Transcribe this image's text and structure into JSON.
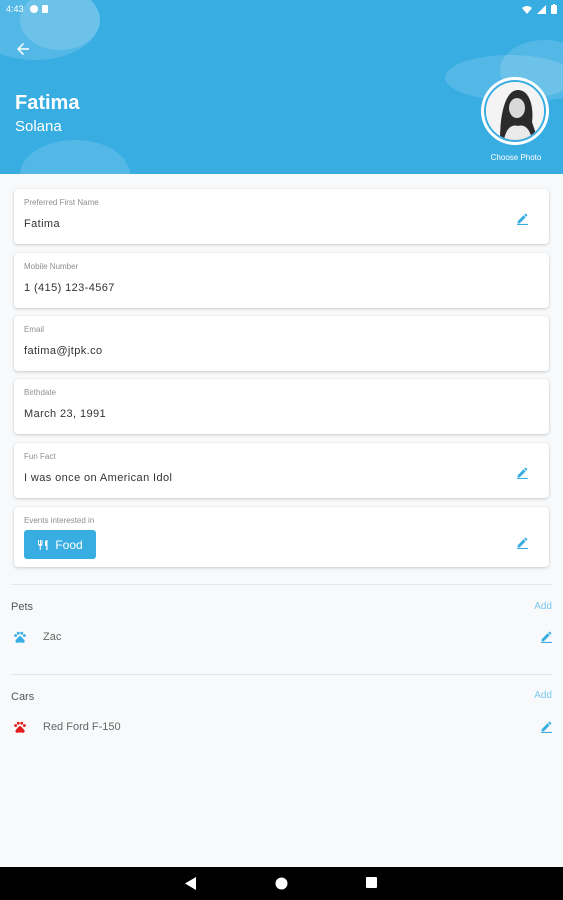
{
  "status_bar": {
    "time": "4:43"
  },
  "header": {
    "first_name": "Fatima",
    "last_name": "Solana",
    "choose_photo_label": "Choose Photo"
  },
  "fields": [
    {
      "label": "Preferred First Name",
      "value": "Fatima",
      "editable": true
    },
    {
      "label": "Mobile Number",
      "value": "1 (415) 123-4567",
      "editable": false
    },
    {
      "label": "Email",
      "value": "fatima@jtpk.co",
      "editable": false
    },
    {
      "label": "Birthdate",
      "value": "March 23, 1991",
      "editable": false
    },
    {
      "label": "Fun Fact",
      "value": "I was once on American Idol",
      "editable": true
    }
  ],
  "events": {
    "label": "Events interested in",
    "chips": [
      {
        "label": "Food",
        "icon": "food-icon"
      }
    ]
  },
  "pets": {
    "title": "Pets",
    "add_label": "Add",
    "items": [
      {
        "name": "Zac",
        "icon": "paw-icon",
        "color": "#38ade2"
      }
    ]
  },
  "cars": {
    "title": "Cars",
    "add_label": "Add",
    "items": [
      {
        "name": "Red Ford F-150",
        "icon": "paw-icon",
        "color": "#e31b1b"
      }
    ]
  },
  "colors": {
    "primary": "#38ade2",
    "accent_red": "#e31b1b"
  }
}
